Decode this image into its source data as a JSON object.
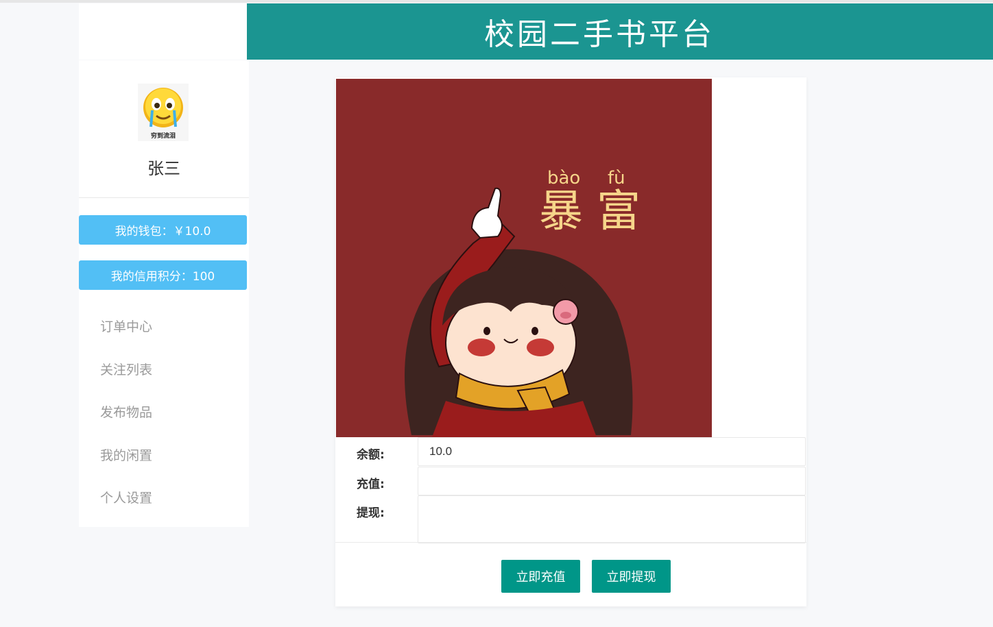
{
  "header": {
    "title": "校园二手书平台"
  },
  "sidebar": {
    "avatar_caption": "穷到流泪",
    "username": "张三",
    "wallet_label": "我的钱包：￥10.0",
    "credit_label": "我的信用积分：100",
    "menu": [
      {
        "label": "订单中心"
      },
      {
        "label": "关注列表"
      },
      {
        "label": "发布物品"
      },
      {
        "label": "我的闲置"
      },
      {
        "label": "个人设置"
      }
    ]
  },
  "main": {
    "picture": {
      "pinyin_1": "bào",
      "pinyin_2": "fù",
      "text": "暴富"
    },
    "form": {
      "balance_label": "余额:",
      "balance_value": "10.0",
      "recharge_label": "充值:",
      "recharge_value": "",
      "withdraw_label": "提现:",
      "withdraw_value": ""
    },
    "buttons": {
      "recharge": "立即充值",
      "withdraw": "立即提现"
    }
  },
  "colors": {
    "header": "#1b9591",
    "pill": "#52bff5",
    "button": "#009688",
    "picture_bg": "#892a2a"
  }
}
